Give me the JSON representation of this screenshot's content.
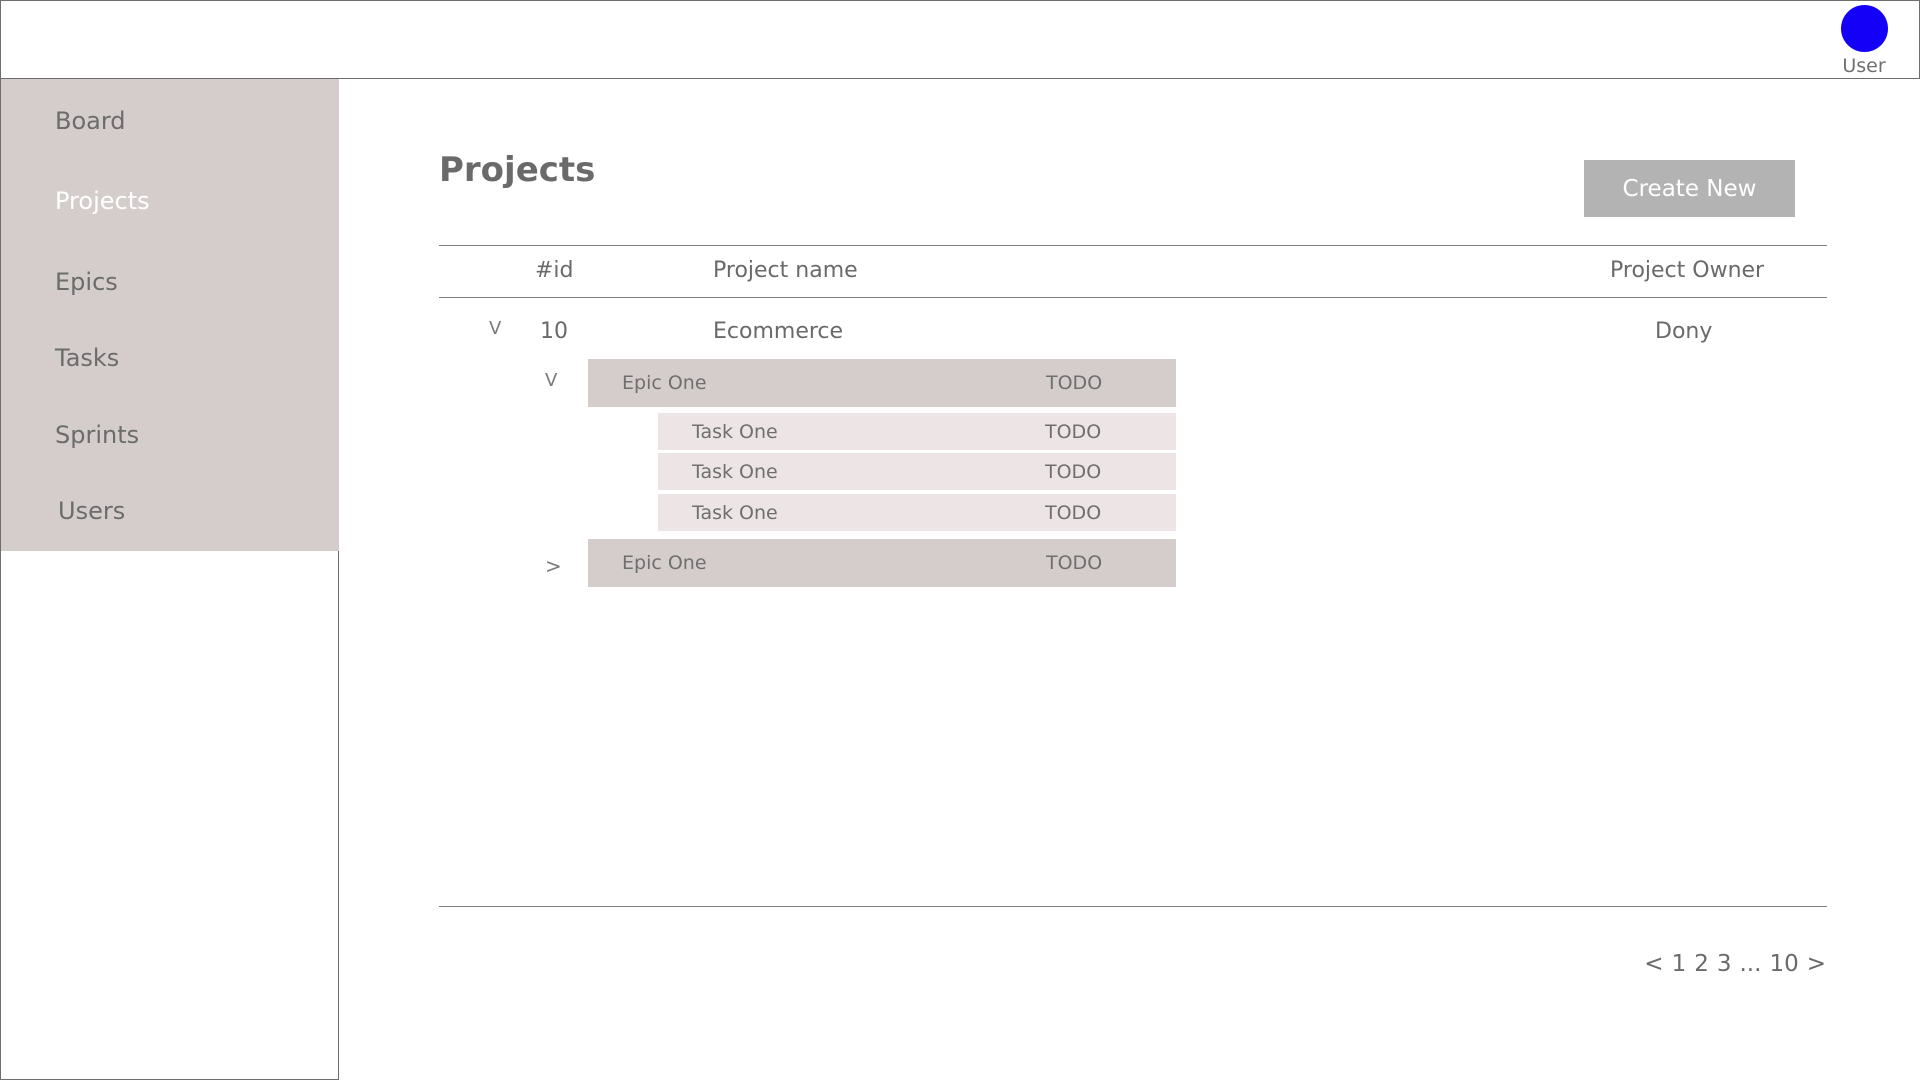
{
  "header": {
    "user_label": "User",
    "avatar_color": "#1400f6"
  },
  "sidebar": {
    "items": [
      {
        "label": "Board",
        "active": false
      },
      {
        "label": "Projects",
        "active": true
      },
      {
        "label": "Epics",
        "active": false
      },
      {
        "label": "Tasks",
        "active": false
      },
      {
        "label": "Sprints",
        "active": false
      },
      {
        "label": "Users",
        "active": false
      }
    ]
  },
  "main": {
    "title": "Projects",
    "create_button": "Create New",
    "columns": {
      "id": "#id",
      "name": "Project name",
      "owner": "Project Owner"
    },
    "project": {
      "expand_icon": "V",
      "id": "10",
      "name": "Ecommerce",
      "owner": "Dony",
      "epics": [
        {
          "expand_icon": "V",
          "name": "Epic One",
          "status": "TODO",
          "tasks": [
            {
              "name": "Task One",
              "status": "TODO"
            },
            {
              "name": "Task One",
              "status": "TODO"
            },
            {
              "name": "Task One",
              "status": "TODO"
            }
          ]
        },
        {
          "expand_icon": ">",
          "name": "Epic One",
          "status": "TODO"
        }
      ]
    },
    "pagination": {
      "prev": "<",
      "pages": [
        "1",
        "2",
        "3",
        "...",
        "10"
      ],
      "next": ">"
    }
  }
}
